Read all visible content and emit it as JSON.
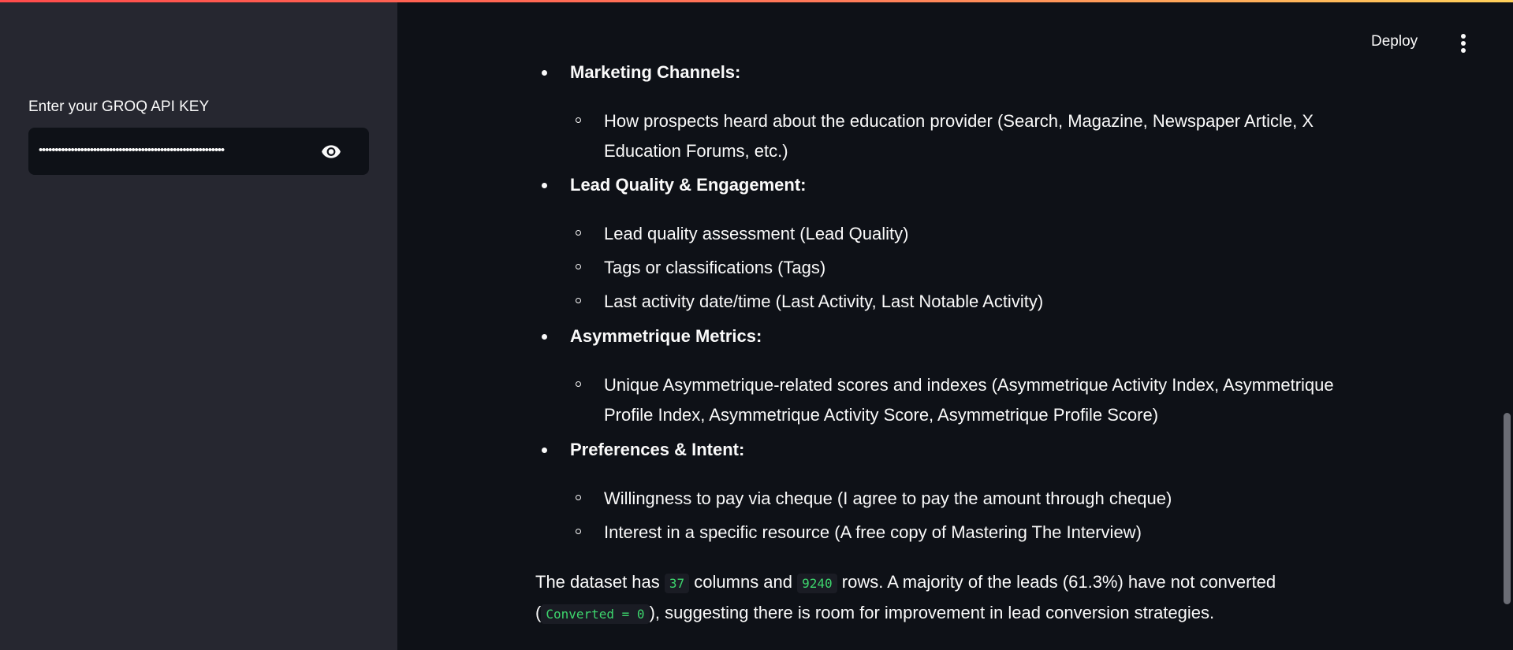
{
  "sidebar": {
    "api_key_label": "Enter your GROQ API KEY",
    "api_key_value": "••••••••••••••••••••••••••••••••••••••••••••••••••••••••••",
    "toggle_icon": "eye-icon"
  },
  "header": {
    "deploy_label": "Deploy",
    "menu_icon": "kebab-menu-icon"
  },
  "content": {
    "sections": [
      {
        "title": "Marketing Channels:",
        "items": [
          {
            "lines": [
              "How prospects heard about the education provider (Search, Magazine, Newspaper Article, X",
              "Education Forums, etc.)"
            ]
          }
        ]
      },
      {
        "title": "Lead Quality & Engagement:",
        "items": [
          {
            "lines": [
              "Lead quality assessment (Lead Quality)"
            ]
          },
          {
            "lines": [
              "Tags or classifications (Tags)"
            ]
          },
          {
            "lines": [
              "Last activity date/time (Last Activity, Last Notable Activity)"
            ]
          }
        ]
      },
      {
        "title": "Asymmetrique Metrics:",
        "items": [
          {
            "lines": [
              "Unique Asymmetrique-related scores and indexes (Asymmetrique Activity Index, Asymmetrique",
              "Profile Index, Asymmetrique Activity Score, Asymmetrique Profile Score)"
            ]
          }
        ]
      },
      {
        "title": "Preferences & Intent:",
        "items": [
          {
            "lines": [
              "Willingness to pay via cheque (I agree to pay the amount through cheque)"
            ]
          },
          {
            "lines": [
              "Interest in a specific resource (A free copy of Mastering The Interview)"
            ]
          }
        ]
      }
    ],
    "summary": {
      "p1": "The dataset has ",
      "columns": "37",
      "p2": " columns and ",
      "rows": "9240",
      "p3": " rows. A majority of the leads (61.3%) have not converted",
      "p4": "(",
      "code": "Converted = 0",
      "p5": "), suggesting there is room for improvement in lead conversion strategies."
    }
  },
  "colors": {
    "background": "#0e1117",
    "sidebar": "#262730",
    "code_text": "#3dd56d"
  }
}
